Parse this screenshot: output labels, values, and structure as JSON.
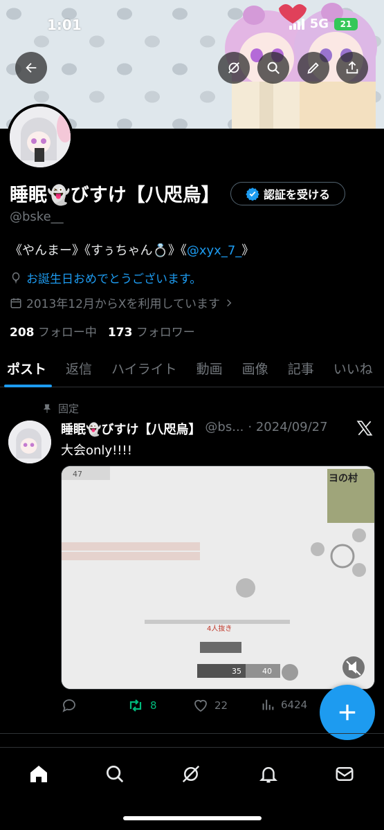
{
  "status_bar": {
    "time": "1:01",
    "network": "5G",
    "battery": "21"
  },
  "profile": {
    "display_name": "睡眠👻びすけ【八咫烏】",
    "verify_button": "認証を受ける",
    "handle": "@bske__",
    "bio_prefix": "《やんまー》《すぅちゃん💍》《",
    "bio_link": "@xyx_7_",
    "bio_suffix": "》",
    "birthday_text": "お誕生日おめでとうございます。",
    "joined_text": "2013年12月からXを利用しています",
    "following_count": "208",
    "following_label": "フォロー中",
    "followers_count": "173",
    "followers_label": "フォロワー"
  },
  "tabs": [
    {
      "label": "ポスト"
    },
    {
      "label": "返信"
    },
    {
      "label": "ハイライト"
    },
    {
      "label": "動画"
    },
    {
      "label": "画像"
    },
    {
      "label": "記事"
    },
    {
      "label": "いいね"
    }
  ],
  "tweet": {
    "pinned_label": "固定",
    "author_name": "睡眠👻びすけ【八咫烏】",
    "author_handle": "@bs...",
    "date": "· 2024/09/27",
    "text": "大会only!!!!",
    "media_texts": {
      "level": "47",
      "kill_text": "4人抜き",
      "map_label": "ヨの村",
      "ammo_left": "35",
      "ammo_right": "40"
    },
    "reply_count": "",
    "retweet_count": "8",
    "like_count": "22",
    "views_count": "6424"
  },
  "colors": {
    "accent": "#1d9bf0",
    "retweet": "#00ba7c",
    "muted": "#71767b"
  },
  "icons": [
    "back-arrow-icon",
    "grok-icon",
    "search-icon",
    "edit-icon",
    "share-icon",
    "balloon-icon",
    "calendar-icon",
    "pin-icon",
    "x-logo-icon",
    "reply-icon",
    "retweet-icon",
    "like-icon",
    "views-icon",
    "compose-plus-icon",
    "home-icon",
    "explore-icon",
    "grok-nav-icon",
    "notifications-icon",
    "messages-icon"
  ]
}
